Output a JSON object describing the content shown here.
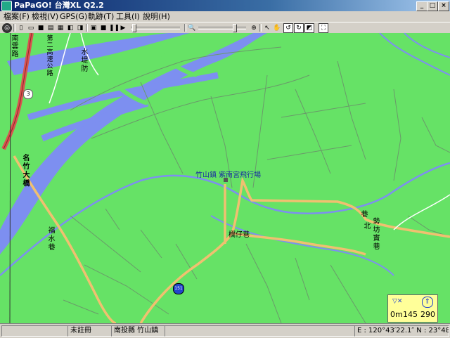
{
  "window": {
    "title": "PaPaGO! 台灣XL Q2.2",
    "controls": [
      "_",
      "□",
      "×"
    ]
  },
  "menu": [
    {
      "label": "檔案(F)"
    },
    {
      "label": "檢視(V)"
    },
    {
      "label": "GPS(G)"
    },
    {
      "label": "軌跡(T)"
    },
    {
      "label": "工具(I)"
    },
    {
      "label": "說明(H)"
    }
  ],
  "map": {
    "places": {
      "airfield": "竹山鎮 紫南宮飛行場",
      "lane_zaizai": "欄仔巷",
      "highway_shield": "3",
      "provincial_shield": "151"
    },
    "vertical_labels": {
      "highway": "第二高速公路",
      "nanyun_road": "南雲路",
      "dike": "水堤防",
      "bridge": "名竹大橋",
      "fuyun_lane": "福水巷",
      "xiang": "巷",
      "north": "北",
      "lane_east": "勢坊竇巷"
    },
    "colors": {
      "land": "#66e266",
      "water": "#7d8ff0",
      "major_road": "#f0c070",
      "highway": "#d9534f"
    }
  },
  "scale": {
    "distance": "0m",
    "value": "145",
    "heading": "290"
  },
  "status": {
    "registration": "未註冊",
    "region": "南投縣 竹山鎮",
    "coords": "E : 120°43′22.1″  N : 23°48′58.4″"
  }
}
